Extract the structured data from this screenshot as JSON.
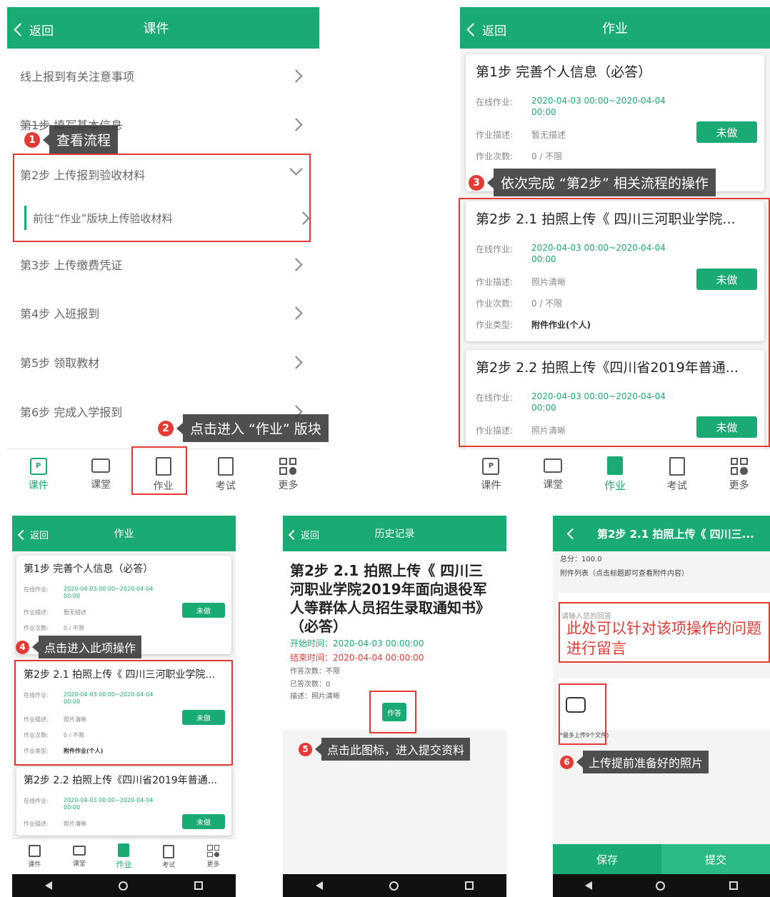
{
  "colors": {
    "primary": "#1aaa73",
    "annotation_red": "#e53935"
  },
  "icons": {
    "back": "chevron-left-icon",
    "row": "chevron-right-icon",
    "expanded": "chevron-down-icon",
    "kejian": "courseware-icon",
    "ketang": "classroom-icon",
    "zuoye": "homework-icon",
    "kaoshi": "exam-icon",
    "gengduo": "more-icon",
    "upload": "image-upload-icon"
  },
  "common": {
    "back": "返回",
    "not_done": "未做",
    "tabs": [
      "课件",
      "课堂",
      "作业",
      "考试",
      "更多"
    ],
    "labels": {
      "online": "在线作业:",
      "desc": "作业描述:",
      "count": "作业次数:",
      "type": "作业类型:"
    }
  },
  "s1": {
    "title": "课件",
    "rows": [
      "线上报到有关注意事项",
      "第1步 填写基本信息",
      "第2步 上传报到验收材料",
      "前往“作业”版块上传验收材料",
      "第3步 上传缴费凭证",
      "第4步 入班报到",
      "第5步 领取教材",
      "第6步 完成入学报到"
    ],
    "tips": {
      "t1": "查看流程",
      "t2": "点击进入 “作业” 版块"
    }
  },
  "s2": {
    "title": "作业",
    "cards": [
      {
        "title": "第1步 完善个人信息（必答）",
        "time1": "2020-04-03 00:00~2020-04-04",
        "time2": "00:00",
        "desc": "暂无描述",
        "count": "0 / 不限"
      },
      {
        "title": "第2步 2.1 拍照上传《 四川三河职业学院...",
        "time1": "2020-04-03 00:00~2020-04-04",
        "time2": "00:00",
        "desc": "照片清晰",
        "count": "0 / 不限",
        "type": "附件作业(个人)"
      },
      {
        "title": "第2步 2.2 拍照上传《四川省2019年普通...",
        "time1": "2020-04-03 00:00~2020-04-04",
        "time2": "00:00",
        "desc": "照片清晰"
      }
    ],
    "tip3": "依次完成 “第2步” 相关流程的操作"
  },
  "s3": {
    "title": "作业",
    "tip4": "点击进入此项操作"
  },
  "s4": {
    "title": "历史记录",
    "heading": "第2步 2.1 拍照上传《 四川三河职业学院2019年面向退役军人等群体人员招生录取通知书》（必答）",
    "start": "开始时间：2020-04-03 00:00:00",
    "end": "结束时间：2020-04-04 00:00:00",
    "answer_count": "作答次数：不限",
    "answered": "已答次数：0",
    "desc": "描述：照片清晰",
    "action": "作答",
    "tip5": "点击此图标，进入提交资料"
  },
  "s5": {
    "title": "第2步 2.1 拍照上传《 四川三...",
    "score": "总分：100.0",
    "attach": "附件列表（点击标题即可查看附件内容）",
    "placeholder": "请输入您的回答",
    "note": "此处可以针对该项操作的问题进行留言",
    "limit": "*最多上传9个文件)",
    "tip6": "上传提前准备好的照片",
    "save": "保存",
    "submit": "提交"
  }
}
